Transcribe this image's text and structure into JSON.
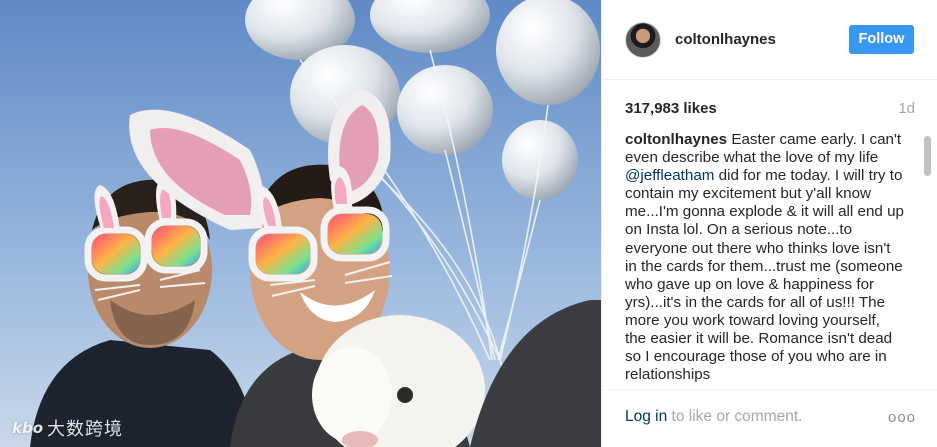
{
  "photo": {
    "watermark_logo": "kbo",
    "watermark_text": "大数跨境"
  },
  "header": {
    "username": "coltonlhaynes",
    "follow_label": "Follow"
  },
  "stats": {
    "likes": "317,983 likes",
    "time": "1d"
  },
  "caption": {
    "user": "coltonlhaynes",
    "text_before_mention": "Easter came early. I can't even describe what the love of my life",
    "mention": "@jeffleatham",
    "text_after_mention": "did for me today. I will try to contain my excitement but y'all know me...I'm gonna explode & it will all end up on Insta lol. On a serious note...to everyone out there who thinks love isn't in the cards for them...trust me (someone who gave up on love & happiness for yrs)...it's in the cards for all of us!!! The more you work toward loving yourself, the easier it will be. Romance isn't dead so I encourage those of you who are in relationships"
  },
  "footer": {
    "login_label": "Log in",
    "suffix": "to like or comment.",
    "more_label": "ooo"
  },
  "colors": {
    "accent": "#3897f0",
    "link": "#003569",
    "muted": "#a5a7aa"
  }
}
